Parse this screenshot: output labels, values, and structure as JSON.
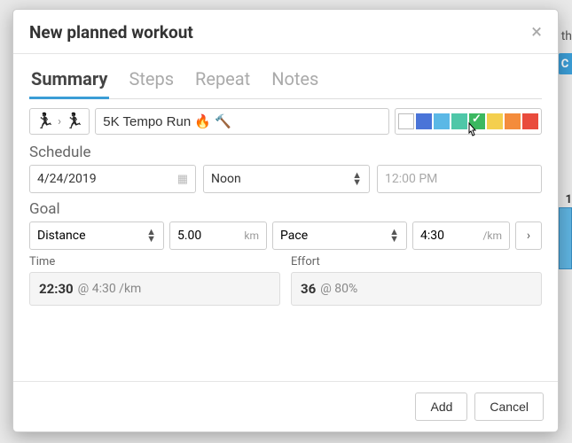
{
  "modal": {
    "title": "New planned workout",
    "tabs": [
      "Summary",
      "Steps",
      "Repeat",
      "Notes"
    ],
    "active_tab": 0,
    "workout_name": "5K Tempo Run 🔥 🔨",
    "colors": [
      {
        "hex": "#ffffff",
        "name": "white"
      },
      {
        "hex": "#4a74d8",
        "name": "blue"
      },
      {
        "hex": "#5bb8e6",
        "name": "light-blue"
      },
      {
        "hex": "#4fc7a8",
        "name": "teal"
      },
      {
        "hex": "#3cb860",
        "name": "green",
        "selected": true
      },
      {
        "hex": "#f4cf4e",
        "name": "yellow"
      },
      {
        "hex": "#f48c3c",
        "name": "orange"
      },
      {
        "hex": "#e94b3c",
        "name": "red"
      }
    ],
    "schedule": {
      "label": "Schedule",
      "date": "4/24/2019",
      "time_option": "Noon",
      "time_display": "12:00 PM"
    },
    "goal": {
      "label": "Goal",
      "type1": "Distance",
      "val1": "5.00",
      "unit1": "km",
      "type2": "Pace",
      "val2": "4:30",
      "unit2": "/km"
    },
    "time": {
      "label": "Time",
      "value": "22:30",
      "suffix": "@ 4:30 /km"
    },
    "effort": {
      "label": "Effort",
      "value": "36",
      "suffix": "@ 80%"
    },
    "buttons": {
      "add": "Add",
      "cancel": "Cancel"
    }
  },
  "bg": {
    "hint": "th",
    "btn": "C",
    "num": "1"
  }
}
